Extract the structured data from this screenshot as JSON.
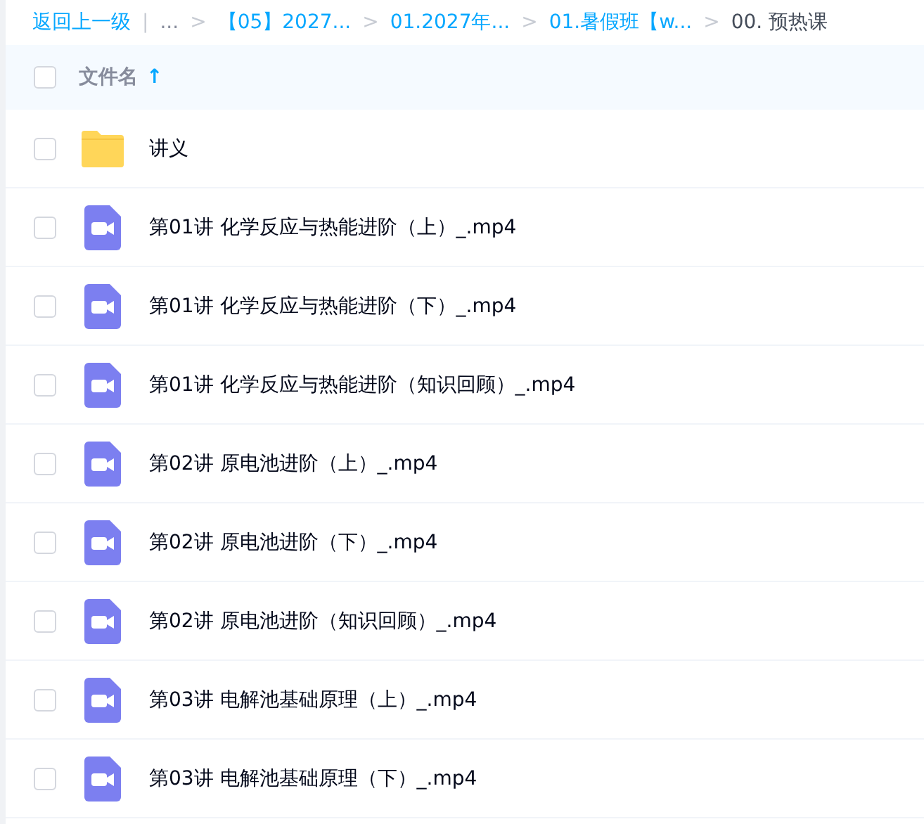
{
  "breadcrumb": {
    "back": "返回上一级",
    "separator": "|",
    "ellipsis": "...",
    "arrow": ">",
    "crumbs": [
      "【05】2027...",
      "01.2027年...",
      "01.暑假班【w..."
    ],
    "current": "00. 预热课"
  },
  "header": {
    "checked": false,
    "column": "文件名",
    "sort_icon": "↑"
  },
  "files": [
    {
      "kind": "folder",
      "name": "讲义",
      "checked": false
    },
    {
      "kind": "video",
      "name": "第01讲 化学反应与热能进阶（上）_.mp4",
      "checked": false
    },
    {
      "kind": "video",
      "name": "第01讲 化学反应与热能进阶（下）_.mp4",
      "checked": false
    },
    {
      "kind": "video",
      "name": "第01讲 化学反应与热能进阶（知识回顾）_.mp4",
      "checked": false
    },
    {
      "kind": "video",
      "name": "第02讲 原电池进阶（上）_.mp4",
      "checked": false
    },
    {
      "kind": "video",
      "name": "第02讲 原电池进阶（下）_.mp4",
      "checked": false
    },
    {
      "kind": "video",
      "name": "第02讲 原电池进阶（知识回顾）_.mp4",
      "checked": false
    },
    {
      "kind": "video",
      "name": "第03讲 电解池基础原理（上）_.mp4",
      "checked": false
    },
    {
      "kind": "video",
      "name": "第03讲 电解池基础原理（下）_.mp4",
      "checked": false
    }
  ]
}
